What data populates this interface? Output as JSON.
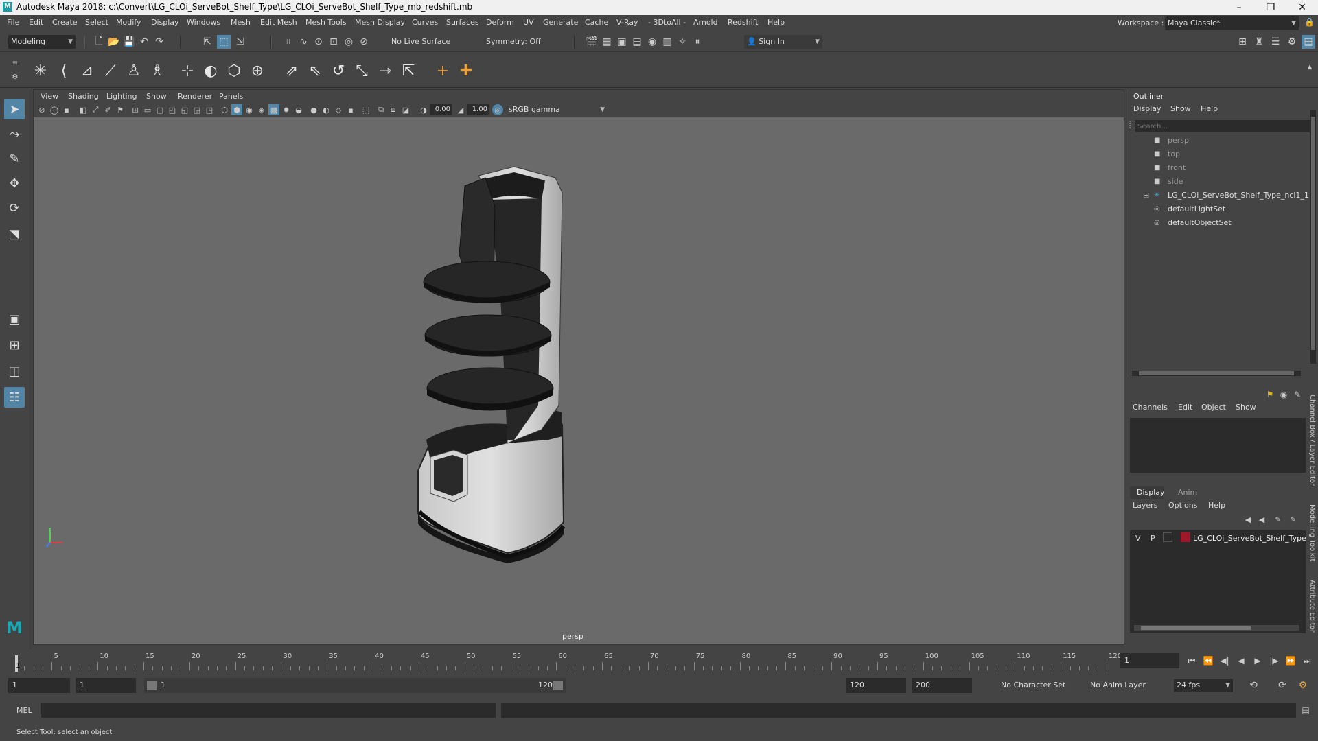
{
  "window": {
    "title": "Autodesk Maya 2018: c:\\Convert\\LG_CLOi_ServeBot_Shelf_Type\\LG_CLOi_ServeBot_Shelf_Type_mb_redshift.mb",
    "logo": "M",
    "min": "–",
    "max": "❐",
    "close": "✕"
  },
  "menubar": {
    "items": [
      "File",
      "Edit",
      "Create",
      "Select",
      "Modify",
      "Display",
      "Windows",
      "Mesh",
      "Edit Mesh",
      "Mesh Tools",
      "Mesh Display",
      "Curves",
      "Surfaces",
      "Deform",
      "UV",
      "Generate",
      "Cache",
      "V-Ray",
      "- 3DtoAll -",
      "Arnold",
      "Redshift",
      "Help"
    ],
    "workspace_label": "Workspace :",
    "workspace_value": "Maya Classic*"
  },
  "statusline": {
    "mode": "Modeling",
    "live_surface": "No Live Surface",
    "symmetry": "Symmetry: Off",
    "sign_in": "Sign In"
  },
  "viewport": {
    "menu": [
      "View",
      "Shading",
      "Lighting",
      "Show",
      "Renderer",
      "Panels"
    ],
    "exposure": "0.00",
    "gamma": "1.00",
    "color_space": "sRGB gamma",
    "camera": "persp"
  },
  "outliner": {
    "title": "Outliner",
    "menu": [
      "Display",
      "Show",
      "Help"
    ],
    "search_placeholder": "Search...",
    "items": [
      {
        "label": "persp",
        "icon": "camera-icon"
      },
      {
        "label": "top",
        "icon": "camera-icon"
      },
      {
        "label": "front",
        "icon": "camera-icon"
      },
      {
        "label": "side",
        "icon": "camera-icon"
      },
      {
        "label": "LG_CLOi_ServeBot_Shelf_Type_ncl1_1",
        "icon": "transform-icon"
      },
      {
        "label": "defaultLightSet",
        "icon": "set-icon"
      },
      {
        "label": "defaultObjectSet",
        "icon": "set-icon"
      }
    ],
    "expand": "⊞"
  },
  "channelbox": {
    "menu": [
      "Channels",
      "Edit",
      "Object",
      "Show"
    ]
  },
  "layers": {
    "tabs": [
      "Display",
      "Anim"
    ],
    "menu": [
      "Layers",
      "Options",
      "Help"
    ],
    "row": {
      "v": "V",
      "p": "P",
      "name": "LG_CLOi_ServeBot_Shelf_Type",
      "color": "#a0182b"
    }
  },
  "side_tabs": [
    "Channel Box / Layer Editor",
    "Modelling Toolkit",
    "Attribute Editor"
  ],
  "timeslider": {
    "labels": [
      "5",
      "10",
      "15",
      "20",
      "25",
      "30",
      "35",
      "40",
      "45",
      "50",
      "55",
      "60",
      "65",
      "70",
      "75",
      "80",
      "85",
      "90",
      "95",
      "100",
      "105",
      "110",
      "115",
      "120"
    ],
    "start_marker": "1",
    "current_frame": "1"
  },
  "range": {
    "start": "1",
    "playback_start": "1",
    "slider_start": "1",
    "slider_end": "120",
    "playback_end": "120",
    "end": "200",
    "character_set": "No Character Set",
    "anim_layer": "No Anim Layer",
    "fps": "24 fps"
  },
  "cmdline": {
    "label": "MEL"
  },
  "helpline": {
    "text": "Select Tool: select an object"
  },
  "colors": {
    "accent": "#5285a6",
    "bg": "#444444",
    "viewport": "#696969"
  }
}
